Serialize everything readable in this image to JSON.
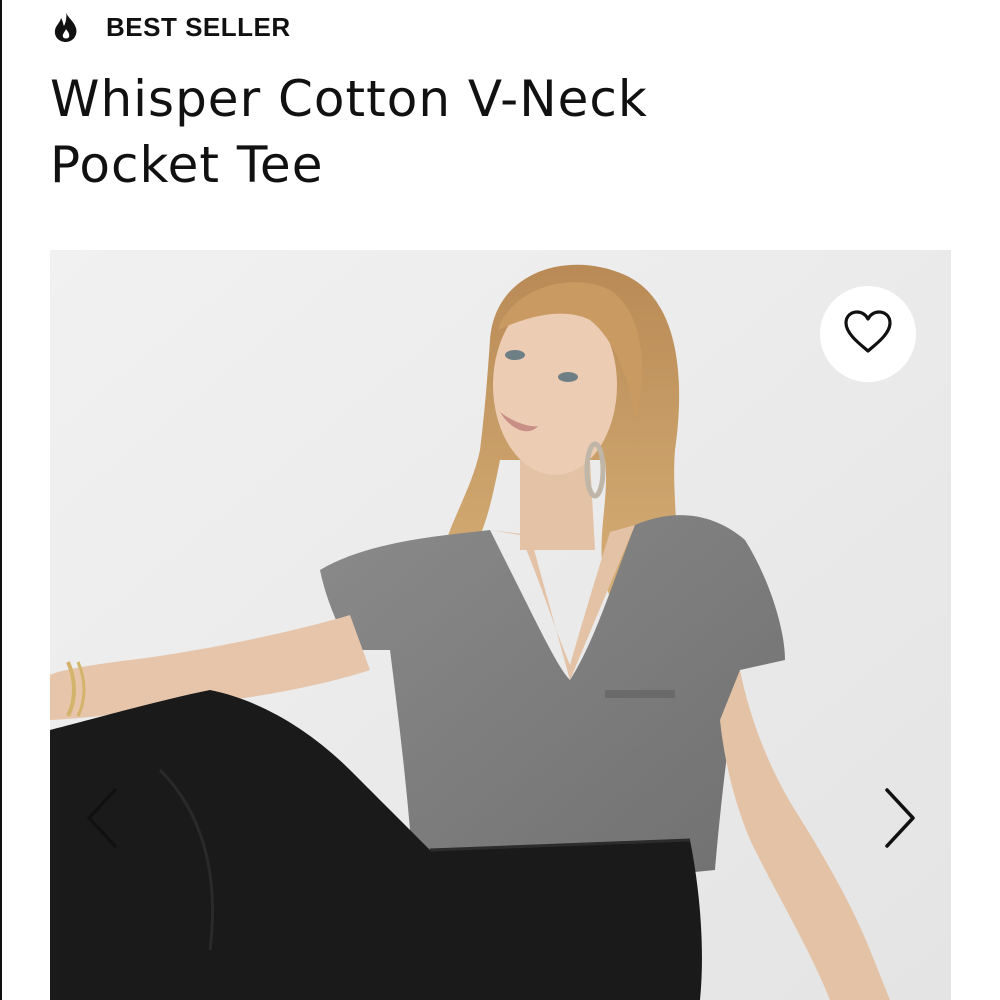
{
  "badge": {
    "label": "BEST SELLER",
    "icon": "flame-icon"
  },
  "product": {
    "title_line1": "Whisper Cotton V-Neck",
    "title_line2": "Pocket Tee"
  },
  "gallery": {
    "favorite_icon": "heart-outline-icon",
    "prev_icon": "chevron-left-icon",
    "next_icon": "chevron-right-icon"
  },
  "colors": {
    "text": "#111111",
    "background": "#ffffff",
    "photo_backdrop": "#ececec",
    "tee": "#808080",
    "jeans": "#1a1a1a",
    "hair": "#c9a270",
    "skin": "#e8c9b0"
  }
}
